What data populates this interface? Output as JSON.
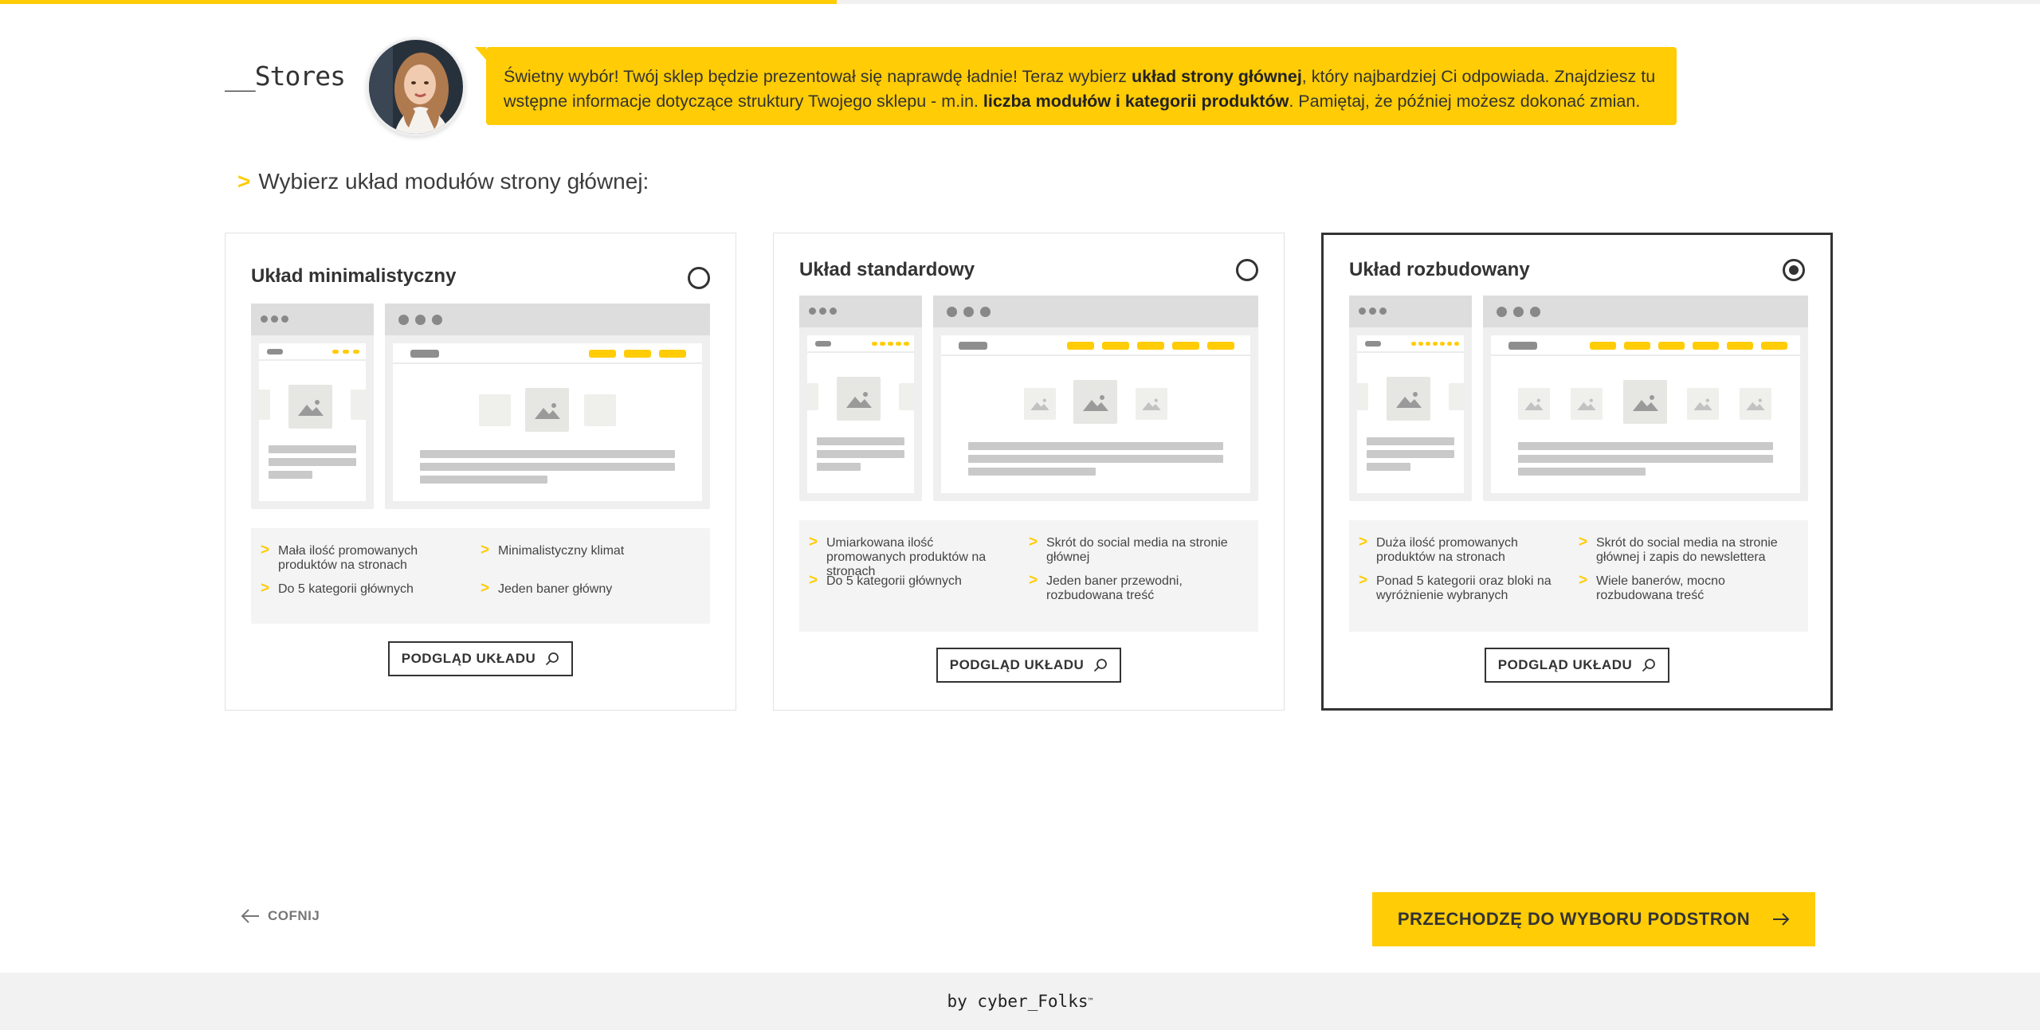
{
  "progress": {
    "value": 0.41,
    "color": "#ffcc05"
  },
  "header": {
    "logo_text": "__Stores",
    "assistant_message": {
      "p1": "Świetny wybór! Twój sklep będzie prezentował się naprawdę ładnie! Teraz wybierz ",
      "b1": "układ strony głównej",
      "p2": ", który najbardziej Ci odpowiada. Znajdziesz tu wstępne informacje dotyczące struktury Twojego sklepu - m.in. ",
      "b2": "liczba modułów i kategorii produktów",
      "p3": ". Pamiętaj, że później możesz dokonać zmian."
    }
  },
  "section": {
    "chevron": ">",
    "title": "Wybierz układ modułów strony głównej:"
  },
  "layouts": [
    {
      "title": "Układ minimalistyczny",
      "selected": false,
      "features": [
        "Mała ilość promowanych produktów na stronach",
        "Minimalistyczny klimat",
        "Do 5 kategorii głównych",
        "Jeden baner główny"
      ],
      "preview_label": "PODGLĄD UKŁADU"
    },
    {
      "title": "Układ standardowy",
      "selected": false,
      "features": [
        "Umiarkowana ilość promowanych produktów na stronach",
        "Skrót do social media na stronie głównej",
        "Do 5 kategorii głównych",
        "Jeden baner przewodni, rozbudowana treść"
      ],
      "preview_label": "PODGLĄD UKŁADU"
    },
    {
      "title": "Układ rozbudowany",
      "selected": true,
      "features": [
        "Duża ilość promowanych produktów na stronach",
        "Skrót do social media na stronie głównej i zapis do newslettera",
        "Ponad 5 kategorii oraz bloki na wyróżnienie wybranych",
        "Wiele banerów, mocno rozbudowana treść"
      ],
      "preview_label": "PODGLĄD UKŁADU"
    }
  ],
  "nav": {
    "back_label": "COFNIJ",
    "next_label": "PRZECHODZĘ DO WYBORU PODSTRON"
  },
  "footer": {
    "prefix": "by ",
    "brand": "cyber_Folks",
    "tm": "™"
  },
  "icons": {
    "search": "search-icon",
    "arrow_left": "arrow-left-icon",
    "arrow_right": "arrow-right-icon",
    "image": "image-placeholder-icon"
  },
  "colors": {
    "accent": "#ffcc05",
    "text": "#333333",
    "footer_bg": "#f2f2f2"
  }
}
